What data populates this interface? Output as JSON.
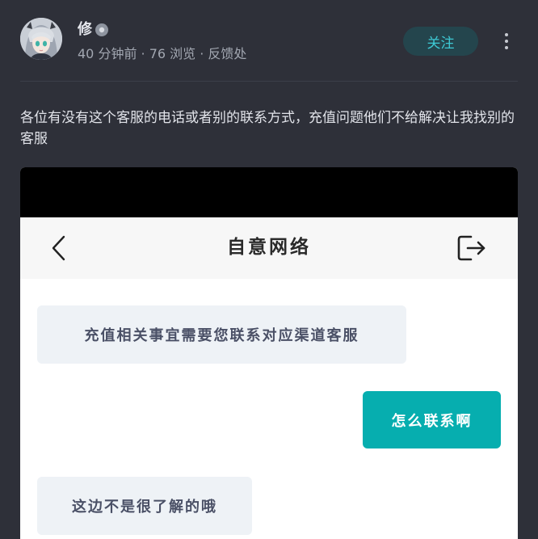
{
  "author": {
    "name": "修",
    "avatar_icon": "anime-avatar-icon",
    "badge_icon": "verified-badge-icon"
  },
  "meta": {
    "text": "40 分钟前 · 76 浏览 · 反馈处"
  },
  "actions": {
    "follow_label": "关注",
    "more_icon": "more-vertical-icon"
  },
  "post": {
    "body": "各位有没有这个客服的电话或者别的联系方式，充值问题他们不给解决让我找别的客服"
  },
  "screenshot": {
    "app_title": "自意网络",
    "back_icon": "chevron-left-icon",
    "logout_icon": "logout-icon",
    "messages": [
      {
        "side": "in",
        "text": "充值相关事宜需要您联系对应渠道客服"
      },
      {
        "side": "out",
        "text": "怎么联系啊"
      },
      {
        "side": "in",
        "text": "这边不是很了解的哦"
      }
    ]
  },
  "colors": {
    "page_bg": "#2e3039",
    "accent": "#3ec9d4",
    "follow_bg": "#24454d",
    "outgoing_bubble": "#06aeaf",
    "incoming_bubble": "#eef2f6"
  }
}
